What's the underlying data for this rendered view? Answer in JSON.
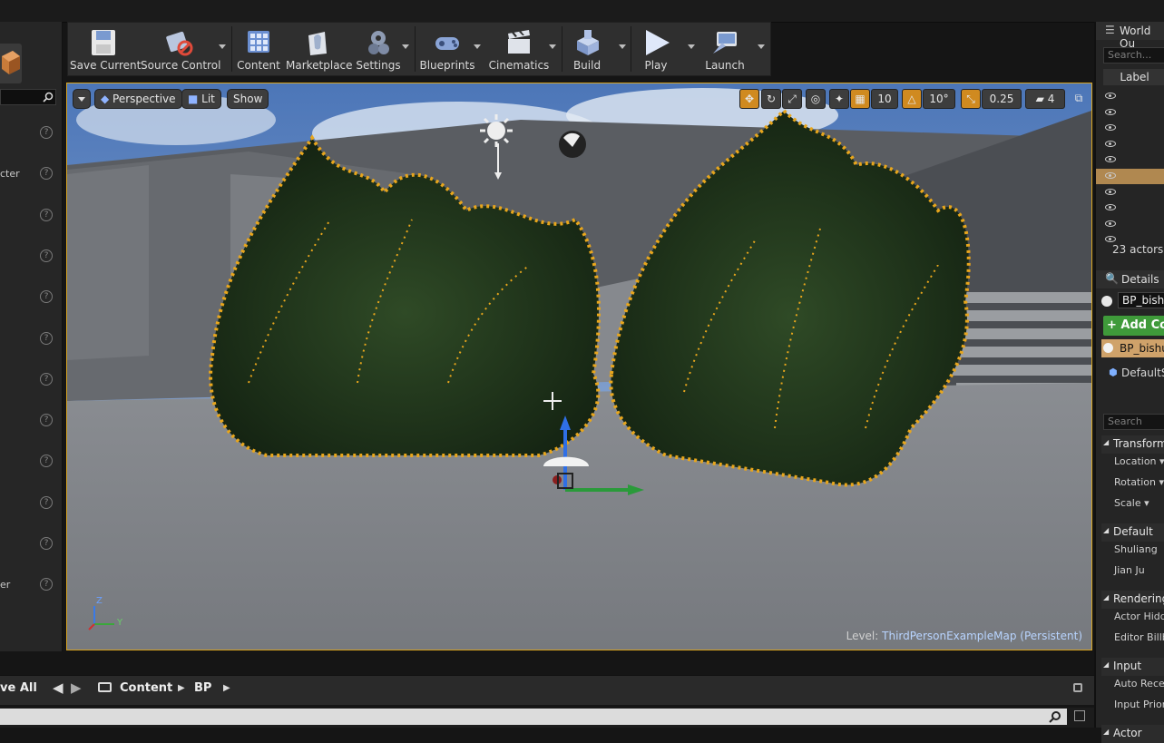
{
  "toolbar": {
    "buttons": [
      {
        "label": "Save Current",
        "icon": "save-icon"
      },
      {
        "label": "Source Control",
        "icon": "source-control-icon"
      },
      {
        "label": "Content",
        "icon": "content-icon"
      },
      {
        "label": "Marketplace",
        "icon": "marketplace-icon"
      },
      {
        "label": "Settings",
        "icon": "settings-icon"
      },
      {
        "label": "Blueprints",
        "icon": "blueprints-icon"
      },
      {
        "label": "Cinematics",
        "icon": "cinematics-icon"
      },
      {
        "label": "Build",
        "icon": "build-icon"
      },
      {
        "label": "Play",
        "icon": "play-icon"
      },
      {
        "label": "Launch",
        "icon": "launch-icon"
      }
    ]
  },
  "left_panel": {
    "rows": [
      {
        "label": ""
      },
      {
        "label": "cter"
      },
      {
        "label": ""
      },
      {
        "label": ""
      },
      {
        "label": ""
      },
      {
        "label": ""
      },
      {
        "label": ""
      },
      {
        "label": ""
      },
      {
        "label": ""
      },
      {
        "label": ""
      },
      {
        "label": ""
      },
      {
        "label": "er"
      }
    ]
  },
  "viewport": {
    "perspective_label": "Perspective",
    "lit_label": "Lit",
    "show_label": "Show",
    "grid_snap": "10",
    "rotation_snap": "10°",
    "scale_snap": "0.25",
    "camera_speed": "4",
    "level_prefix": "Level:",
    "level_name": "ThirdPersonExampleMap (Persistent)",
    "axis_z": "Z",
    "axis_y": "Y"
  },
  "world_outliner": {
    "title": "World Ou",
    "search_placeholder": "Search...",
    "column_label": "Label",
    "actor_count": "23 actors ("
  },
  "details": {
    "title": "Details",
    "name_value": "BP_bishu",
    "add_component_label": "+ Add Co",
    "component_root": "BP_bishu",
    "component_child": "DefaultS",
    "search_placeholder": "Search",
    "categories": [
      {
        "name": "Transform",
        "props": [
          "Location ▾",
          "Rotation ▾",
          "Scale ▾"
        ]
      },
      {
        "name": "Default",
        "props": [
          "Shuliang",
          "Jian Ju"
        ]
      },
      {
        "name": "Rendering",
        "props": [
          "Actor Hidde",
          "Editor Billbo"
        ]
      },
      {
        "name": "Input",
        "props": [
          "Auto Receiv",
          "Input Priorit"
        ]
      },
      {
        "name": "Actor",
        "props": []
      }
    ]
  },
  "content_browser": {
    "save_all_label": "ve All",
    "path": [
      "Content",
      "BP"
    ]
  }
}
